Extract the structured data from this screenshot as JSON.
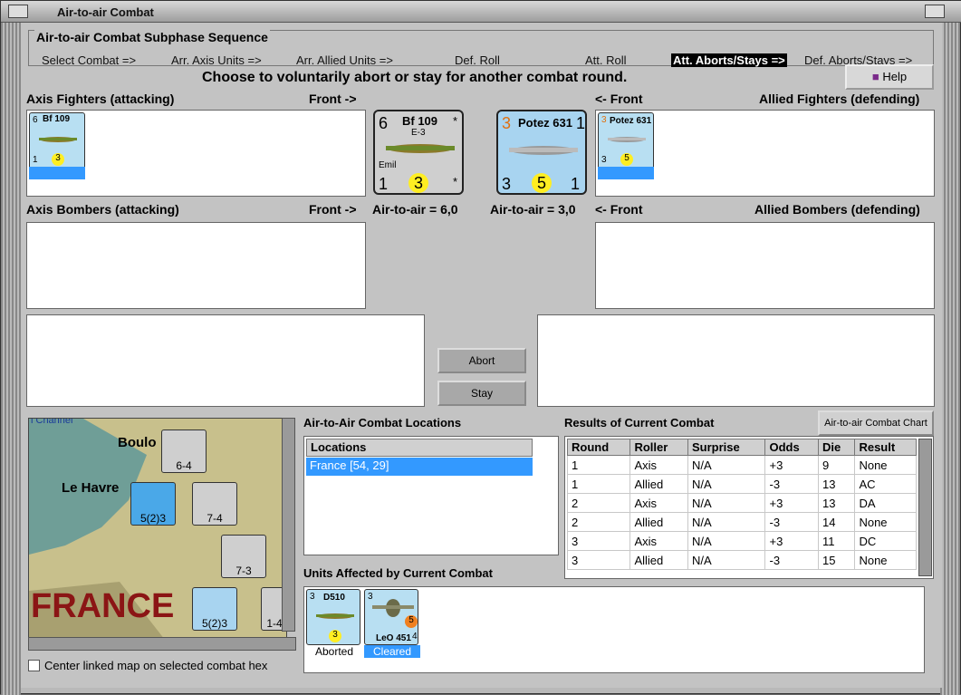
{
  "window": {
    "title": "Air-to-air Combat"
  },
  "sequence": {
    "title": "Air-to-air Combat Subphase Sequence",
    "steps": [
      "Select Combat =>",
      "Arr. Axis Units =>",
      "Arr. Allied Units =>",
      "Def. Roll",
      "Att. Roll",
      "Att. Aborts/Stays =>",
      "Def. Aborts/Stays =>"
    ],
    "active_index": 5
  },
  "instruction": "Choose to voluntarily abort or stay for another combat round.",
  "help_label": "Help",
  "labels": {
    "axis_fighters": "Axis Fighters (attacking)",
    "front_right": "Front ->",
    "front_left": "<- Front",
    "allied_fighters": "Allied Fighters (defending)",
    "axis_bombers": "Axis Bombers (attacking)",
    "allied_bombers": "Allied Bombers (defending)",
    "axis_a2a": "Air-to-air = 6,0",
    "allied_a2a": "Air-to-air = 3,0"
  },
  "axis_fighter": {
    "name": "Bf 109",
    "variant": "E-3",
    "nickname": "Emil",
    "top_left": "6",
    "bottom_left": "1",
    "circle": "3",
    "top_right": "*",
    "bottom_right": "*"
  },
  "allied_fighter": {
    "name": "Potez 631",
    "top_left": "3",
    "top_right": "1",
    "bottom_left": "3",
    "circle": "5",
    "bottom_right": "1"
  },
  "buttons": {
    "abort": "Abort",
    "stay": "Stay",
    "chart": "Air-to-air Combat Chart"
  },
  "locations": {
    "title": "Air-to-Air Combat Locations",
    "header": "Locations",
    "items": [
      "France [54, 29]"
    ]
  },
  "results": {
    "title": "Results of Current Combat",
    "headers": [
      "Round",
      "Roller",
      "Surprise",
      "Odds",
      "Die",
      "Result"
    ],
    "rows": [
      [
        "1",
        "Axis",
        "N/A",
        "+3",
        "9",
        "None"
      ],
      [
        "1",
        "Allied",
        "N/A",
        "-3",
        "13",
        "AC"
      ],
      [
        "2",
        "Axis",
        "N/A",
        "+3",
        "13",
        "DA"
      ],
      [
        "2",
        "Allied",
        "N/A",
        "-3",
        "14",
        "None"
      ],
      [
        "3",
        "Axis",
        "N/A",
        "+3",
        "11",
        "DC"
      ],
      [
        "3",
        "Allied",
        "N/A",
        "-3",
        "15",
        "None"
      ]
    ]
  },
  "units_affected": {
    "title": "Units Affected by Current Combat",
    "units": [
      {
        "name": "D510",
        "status": "Aborted",
        "top_left": "3",
        "circle": "3"
      },
      {
        "name": "LeO 451",
        "status": "Cleared",
        "top_left": "3",
        "circle": "5",
        "bottom_right": "4"
      }
    ]
  },
  "map": {
    "labels": [
      "Boulo",
      "Le Havre",
      "FRANCE",
      "l Channel"
    ],
    "counters": [
      "6-4",
      "7-4",
      "5(2)3",
      "7-3",
      "5(2)3",
      "1-4"
    ]
  },
  "center_linked_label": "Center linked map on selected combat hex",
  "colors": {
    "active_step_bg": "#000000",
    "selection": "#3399ff",
    "allied_counter": "#a8d4f0",
    "axis_counter": "#c8c8c8",
    "circle": "#ffee22"
  }
}
